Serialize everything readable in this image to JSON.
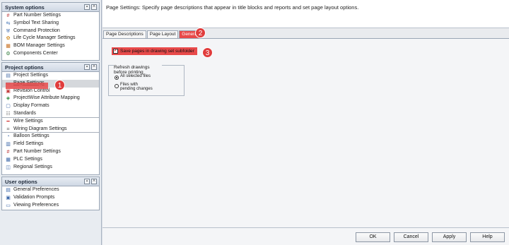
{
  "sections": {
    "system": {
      "title": "System options",
      "items": [
        {
          "label": "Part Number Settings",
          "icon": "hash-icon"
        },
        {
          "label": "Symbol Text Sharing",
          "icon": "text-share-icon"
        },
        {
          "label": "Command Protection",
          "icon": "shield-icon"
        },
        {
          "label": "Life Cycle Manager Settings",
          "icon": "lifecycle-icon"
        },
        {
          "label": "BOM Manager Settings",
          "icon": "bom-icon"
        },
        {
          "label": "Components Center",
          "icon": "components-icon"
        }
      ]
    },
    "project": {
      "title": "Project options",
      "items": [
        {
          "label": "Project Settings",
          "icon": "project-icon"
        },
        {
          "label": "Page Settings",
          "icon": "page-icon"
        },
        {
          "label": "Revision Control",
          "icon": "revision-icon"
        },
        {
          "label": "ProjectWise Attribute Mapping",
          "icon": "projectwise-icon"
        },
        {
          "label": "Display Formats",
          "icon": "display-icon"
        },
        {
          "label": "Standards",
          "icon": "standards-icon"
        },
        {
          "label": "Wire Settings",
          "icon": "wire-icon"
        },
        {
          "label": "Wiring Diagram Settings",
          "icon": "diagram-icon"
        },
        {
          "label": "Balloon Settings",
          "icon": "balloon-icon"
        },
        {
          "label": "Field Settings",
          "icon": "field-icon"
        },
        {
          "label": "Part Number Settings",
          "icon": "hash-icon"
        },
        {
          "label": "PLC Settings",
          "icon": "plc-icon"
        },
        {
          "label": "Regional Settings",
          "icon": "regional-icon"
        }
      ]
    },
    "user": {
      "title": "User options",
      "items": [
        {
          "label": "General Preferences",
          "icon": "preferences-icon"
        },
        {
          "label": "Validation Prompts",
          "icon": "validation-icon"
        },
        {
          "label": "Viewing Preferences",
          "icon": "viewing-icon"
        }
      ]
    }
  },
  "header": {
    "description": "Page Settings: Specify page descriptions that appear in title blocks and reports and set page layout options."
  },
  "tabs": [
    {
      "label": "Page Descriptions"
    },
    {
      "label": "Page Layout"
    },
    {
      "label": "General"
    }
  ],
  "general": {
    "save_subfolder_label": "Save pages in drawing set subfolder",
    "save_subfolder_checked": true,
    "refresh_group_title": "Refresh drawings before printing",
    "radio_all": "All selected files",
    "radio_pending": "Files with pending changes",
    "selected_radio": "All selected files"
  },
  "buttons": {
    "ok": "OK",
    "cancel": "Cancel",
    "apply": "Apply",
    "help": "Help"
  },
  "callouts": [
    "1",
    "2",
    "3"
  ],
  "colors": {
    "highlight": "#e84a4a",
    "badge": "#e03c3c"
  }
}
